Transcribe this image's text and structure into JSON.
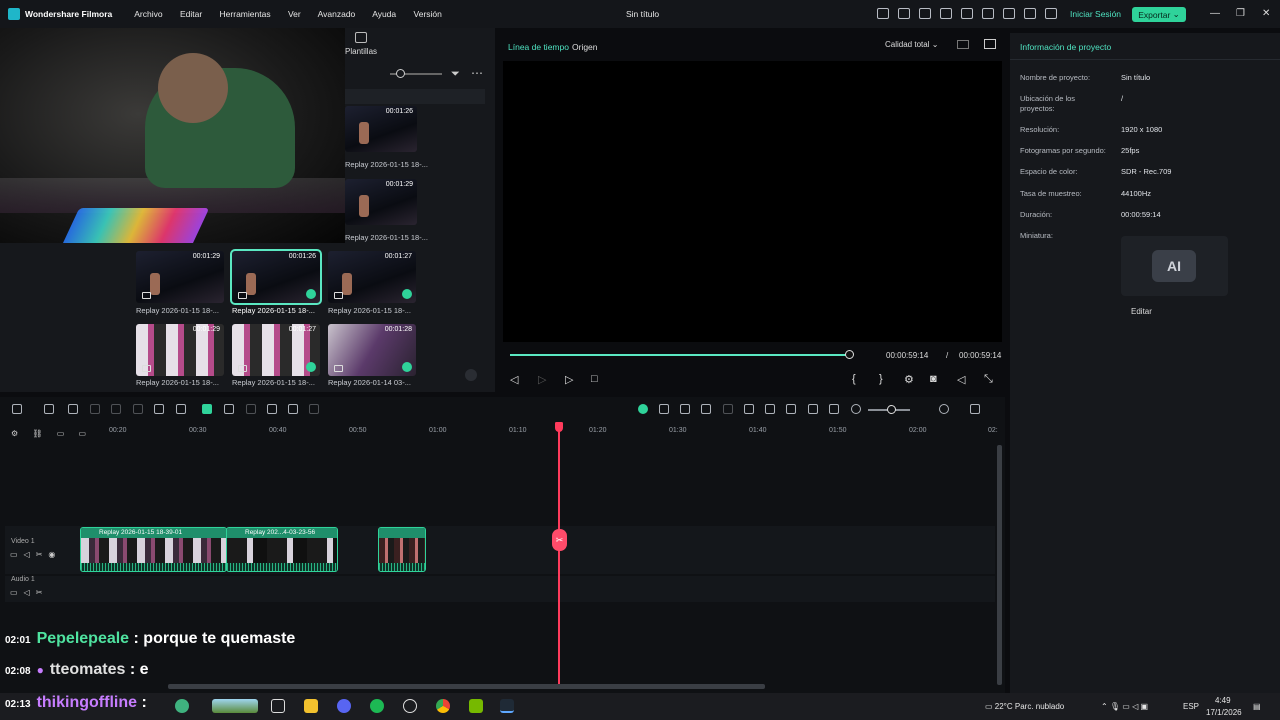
{
  "titlebar": {
    "app_name": "Wondershare Filmora",
    "menu": [
      "Archivo",
      "Editar",
      "Herramientas",
      "Ver",
      "Avanzado",
      "Ayuda",
      "Versión"
    ],
    "document_title": "Sin título",
    "login": "Iniciar Sesión",
    "export": "Exportar"
  },
  "media": {
    "templates_tab": "Plantillas",
    "thumbnails": [
      {
        "duration": "00:01:26",
        "caption": "Replay 2026-01-15 18-..."
      },
      {
        "duration": "00:01:29",
        "caption": "Replay 2026-01-15 18-..."
      },
      {
        "duration": "00:01:29",
        "caption": "Replay 2026-01-15 18-..."
      },
      {
        "duration": "00:01:26",
        "caption": "Replay 2026-01-15 18-..."
      },
      {
        "duration": "00:01:27",
        "caption": "Replay 2026-01-15 18-..."
      },
      {
        "duration": "00:01:29",
        "caption": "Replay 2026-01-15 18-..."
      },
      {
        "duration": "00:01:27",
        "caption": "Replay 2026-01-15 18-..."
      },
      {
        "duration": "00:01:28",
        "caption": "Replay 2026-01-14 03-..."
      }
    ]
  },
  "preview": {
    "tab_timeline": "Línea de tiempo",
    "tab_origin": "Origen",
    "quality": "Calidad total",
    "time_current": "00:00:59:14",
    "time_separator": "/",
    "time_total": "00:00:59:14",
    "progress": 1.0
  },
  "project_info": {
    "title": "Información de proyecto",
    "fields": [
      {
        "key": "Nombre de proyecto:",
        "value": "Sin título"
      },
      {
        "key": "Ubicación de los proyectos:",
        "value": "/"
      },
      {
        "key": "Resolución:",
        "value": "1920 x 1080"
      },
      {
        "key": "Fotogramas por segundo:",
        "value": "25fps"
      },
      {
        "key": "Espacio de color:",
        "value": "SDR - Rec.709"
      },
      {
        "key": "Tasa de muestreo:",
        "value": "44100Hz"
      },
      {
        "key": "Duración:",
        "value": "00:00:59:14"
      },
      {
        "key": "Miniatura:",
        "value": ""
      }
    ],
    "thumbnail_badge": "AI",
    "edit": "Editar"
  },
  "timeline": {
    "ruler": [
      "00:20",
      "00:30",
      "00:40",
      "00:50",
      "01:00",
      "01:10",
      "01:20",
      "01:30",
      "01:40",
      "01:50",
      "02:00",
      "02:"
    ],
    "video_track": "Video 1",
    "audio_track": "Audio 1",
    "clip1_title": "Replay 2026-01-15 18-39-01",
    "clip2_title": "Replay 202...4-03-23-56"
  },
  "chat": [
    {
      "time": "02:01",
      "user": "Pepelepeale",
      "message": " : porque te quemaste",
      "color": "#4fe3a0"
    },
    {
      "time": "02:08",
      "user": "tteomates",
      "message": " : e",
      "color": "#c77dff"
    },
    {
      "time": "02:13",
      "user": "thikingoffline",
      "message": " :",
      "color": "#c77dff"
    }
  ],
  "taskbar": {
    "weather": "22°C  Parc. nublado",
    "language": "ESP",
    "time": "4:49",
    "date": "17/1/2026"
  },
  "colors": {
    "accent": "#2fd39a",
    "playhead": "#ff3b5c"
  }
}
